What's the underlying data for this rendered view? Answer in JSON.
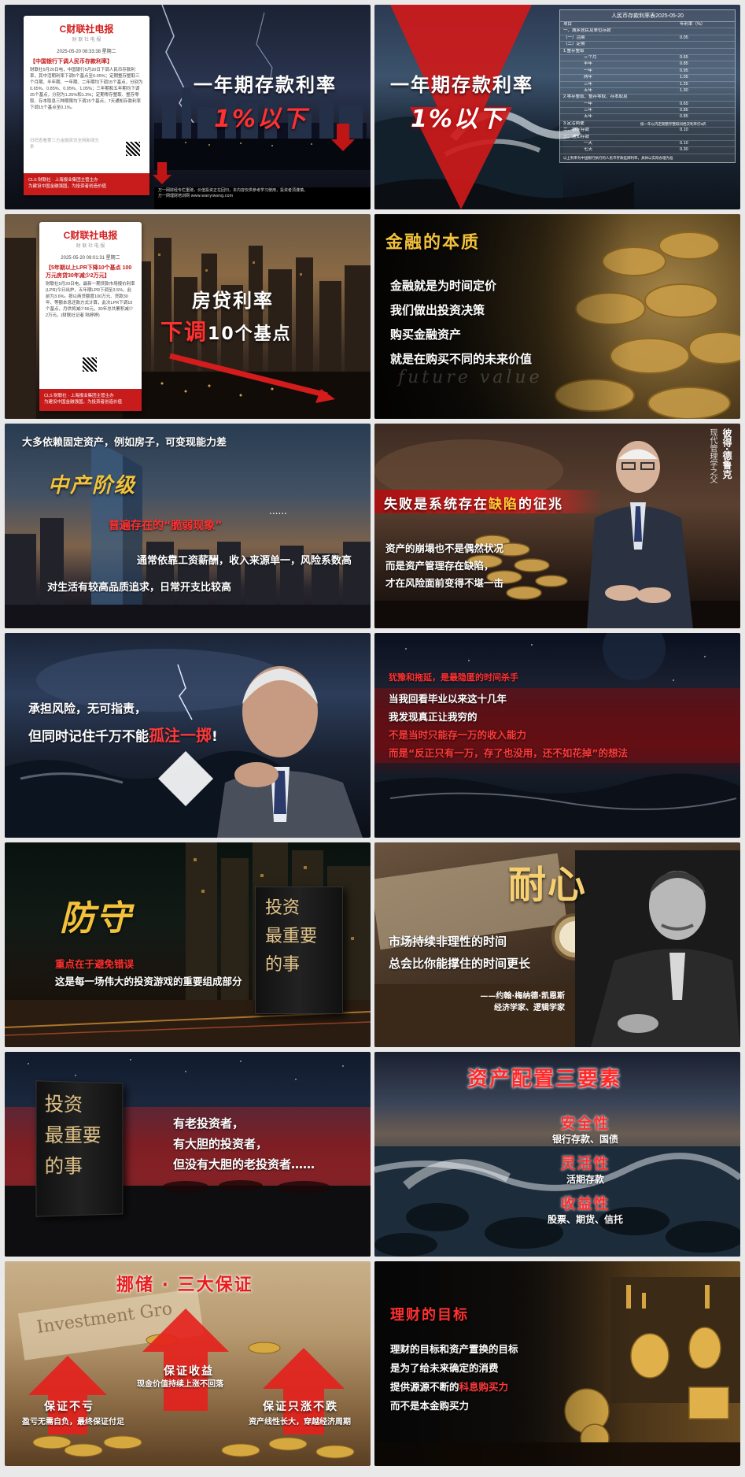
{
  "panels": {
    "p1": {
      "news_logo": "C财联社电报",
      "news_logo_sub": "财 联 社 电 报",
      "news_date": "2025-05-20 08:33:38 星期二",
      "news_headline": "【中国银行下调人民币存款利率】",
      "news_body": "财联社5月20日电，中国银行5月20日下调人民币存款利率，其中活期利率下调5个基点至0.05%；定期整存整取三个月期、半年期、一年期、二年期均下调15个基点，分别为0.65%、0.85%、0.95%、1.05%；三年期和五年期均下调25个基点，分别为1.25%和1.3%；定期零存整取、整存零取、存本取息三种期限均下调15个基点，7天通知存款利率下调15个基点至0.1%。",
      "news_footer_line1": "CLS 财联社 · 上海报业集团主管主办",
      "news_footer_line2": "为建设中国金融强国，为投资者创造价值",
      "news_small_gray": "扫码查看第三方金融资讯全网新闻头条",
      "title_line1": "一年期存款利率",
      "title_line2": "1%以下",
      "bottom_line1": "万一网财经专栏重磅，价值投资正在回归，本内容仅供参考学习使用，投资者须谨慎。",
      "bottom_line2": "万一网理财培训网 www.wanyiwang.com"
    },
    "p2": {
      "title_line1": "一年期存款利率",
      "title_line2": "1%以下",
      "table_title": "人民币存款利率表2025-05-20",
      "table_header": [
        "项目",
        "年利率（%）"
      ],
      "table_rows": [
        [
          "一、城乡居民及单位存款",
          ""
        ],
        [
          "（一）活期",
          "0.05"
        ],
        [
          "（二）定期",
          ""
        ],
        [
          "1.整存整取",
          ""
        ],
        [
          "三个月",
          "0.65"
        ],
        [
          "半年",
          "0.85"
        ],
        [
          "一年",
          "0.95"
        ],
        [
          "两年",
          "1.05"
        ],
        [
          "三年",
          "1.25"
        ],
        [
          "五年",
          "1.30"
        ],
        [
          "2.零存整取、整存零取、存本取息",
          ""
        ],
        [
          "一年",
          "0.65"
        ],
        [
          "三年",
          "0.85"
        ],
        [
          "五年",
          "0.85"
        ],
        [
          "3.定活两便",
          "按一年以内定期整存整取同档次利率打6折"
        ],
        [
          "二、协定存款",
          "0.10"
        ],
        [
          "三、通知存款",
          ""
        ],
        [
          "一天",
          "0.10"
        ],
        [
          "七天",
          "0.30"
        ]
      ],
      "table_footer": "以上利率为中国银行执行的人民币存款挂牌利率，具体以实际办理为准"
    },
    "p3": {
      "news_logo": "C财联社电报",
      "news_logo_sub": "财 联 社 电 报",
      "news_date": "2025-05-20 09:01:31 星期二",
      "news_headline": "【5年期以上LPR下降10个基点 100万元房贷30年减少2万元】",
      "news_body": "财联社5月20日电，最新一期贷款市场报价利率(LPR)今日出炉，五年期LPR下调至3.5%，此前为3.6%。按以商贷额度100万元、贷款30年、等额本息还款方式计算，此次LPR下调10个基点，月供将减少56元，30年总共累积减少2万元。(财联社记者 陆婷婷)",
      "news_footer_line1": "CLS 财联社 · 上海报业集团主管主办",
      "news_footer_line2": "为建设中国金融强国，为投资者创造价值",
      "title_line1": "房贷利率",
      "title_line2_red": "下调",
      "title_line2_white": "10个基点"
    },
    "p4": {
      "title": "金融的本质",
      "lines": [
        "金融就是为时间定价",
        "我们做出投资决策",
        "购买金融资产",
        "就是在购买不同的未来价值"
      ],
      "watermark": "future  value"
    },
    "p5": {
      "top": "大多依赖固定资产，例如房子，可变现能力差",
      "title": "中产阶级",
      "ellipsis": "......",
      "red_text": "普遍存在的“脆弱现象”",
      "line1": "通常依靠工资薪酬，收入来源单一，风险系数高",
      "line2": "对生活有较高品质追求，日常开支比较高"
    },
    "p6": {
      "person_name": "彼得·德鲁克",
      "person_title": "现代管理学之父",
      "banner_pre": "失败是系统存在",
      "banner_hl": "缺陷",
      "banner_post": "的征兆",
      "lines": [
        "资产的崩塌也不是偶然状况",
        "而是资产管理存在缺陷，",
        "才在风险面前变得不堪一击"
      ]
    },
    "p7": {
      "line1": "承担风险，无可指责，",
      "line2_pre": "但同时记住千万不能",
      "line2_hl": "孤注一掷",
      "line2_post": "!"
    },
    "p8": {
      "top": "犹豫和拖延，是最隐匿的时间杀手",
      "line1": "当我回看毕业以来这十几年",
      "line2": "我发现真正让我穷的",
      "line3": "不是当时只能存一万的收入能力",
      "line4_pre": "而是",
      "line4_quote": "“反正只有一万，存了也没用，还不如花掉”",
      "line4_post": "的想法"
    },
    "p9": {
      "title": "防守",
      "red_line": "重点在于避免错误",
      "white_line": "这是每一场伟大的投资游戏的重要组成部分",
      "book_line1": "投资",
      "book_line2": "最重要",
      "book_line3": "的事"
    },
    "p10": {
      "title": "耐心",
      "line1": "市场持续非理性的时间",
      "line2": "总会比你能撑住的时间更长",
      "attribution1": "——约翰·梅纳德·凯恩斯",
      "attribution2": "经济学家、逻辑学家"
    },
    "p11": {
      "book_line1": "投资",
      "book_line2": "最重要",
      "book_line3": "的事",
      "line1": "有老投资者，",
      "line2": "有大胆的投资者，",
      "line3": "但没有大胆的老投资者……"
    },
    "p12": {
      "title": "资产配置三要素",
      "items": [
        {
          "name": "安全性",
          "desc": "银行存款、国债"
        },
        {
          "name": "灵活性",
          "desc": "活期存款"
        },
        {
          "name": "收益性",
          "desc": "股票、期货、信托"
        }
      ]
    },
    "p13": {
      "title": "挪储 · 三大保证",
      "left_label": "保证不亏",
      "left_desc": "盈亏无需自负，最终保证付足",
      "mid_label": "保证收益",
      "mid_desc": "现金价值持续上涨不回落",
      "right_label": "保证只涨不跌",
      "right_desc": "资产线性长大，穿越经济周期",
      "bg_text": "Investment Gro"
    },
    "p14": {
      "title": "理财的目标",
      "line1": "理财的目标和资产置换的目标",
      "line2": "是为了给未来确定的消费",
      "line3_pre": "提供源源不断的",
      "line3_hl": "科息购买力",
      "line4": "而不是本金购买力"
    }
  },
  "colors": {
    "accent_red": "#ff3030",
    "gold": "#f2c23a",
    "brand_red": "#c81c1c"
  }
}
